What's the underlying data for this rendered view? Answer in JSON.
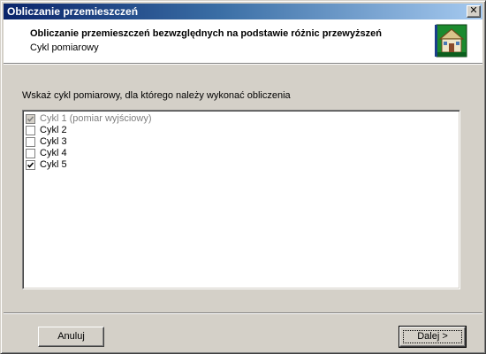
{
  "window": {
    "title": "Obliczanie przemieszczeń",
    "close_label": "✕"
  },
  "header": {
    "title": "Obliczanie przemieszczeń bezwzględnych na podstawie różnic przewyższeń",
    "subtitle": "Cykl pomiarowy",
    "icon": "wizard-house-icon"
  },
  "instruction": "Wskaż cykl pomiarowy, dla którego należy wykonać obliczenia",
  "cycles": [
    {
      "label": "Cykl 1 (pomiar wyjściowy)",
      "checked": true,
      "disabled": true
    },
    {
      "label": "Cykl 2",
      "checked": false,
      "disabled": false
    },
    {
      "label": "Cykl 3",
      "checked": false,
      "disabled": false
    },
    {
      "label": "Cykl 4",
      "checked": false,
      "disabled": false
    },
    {
      "label": "Cykl 5",
      "checked": true,
      "disabled": false
    }
  ],
  "buttons": {
    "cancel": "Anuluj",
    "next": "Dalej >"
  },
  "colors": {
    "titlebar_start": "#0a246a",
    "titlebar_end": "#a6caf0",
    "face": "#d4d0c8"
  }
}
